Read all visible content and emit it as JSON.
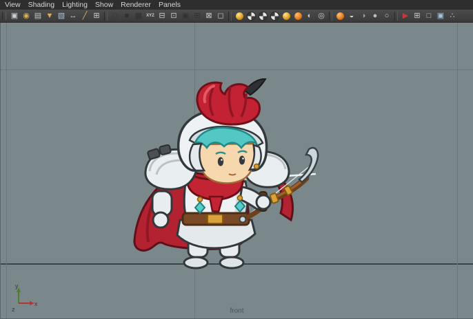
{
  "menu_bar": {
    "items": [
      "View",
      "Shading",
      "Lighting",
      "Show",
      "Renderer",
      "Panels"
    ]
  },
  "toolbar": {
    "groups": [
      {
        "icons": [
          {
            "name": "camera-select-icon",
            "kind": "glyph",
            "glyph": "▣",
            "color": "#c9ced2"
          },
          {
            "name": "camera-lock-icon",
            "kind": "glyph",
            "glyph": "◉",
            "color": "#d8b25a"
          },
          {
            "name": "camera-attributes-icon",
            "kind": "glyph",
            "glyph": "▤",
            "color": "#bfc6ca"
          },
          {
            "name": "bookmark-icon",
            "kind": "glyph",
            "glyph": "▼",
            "color": "#d8b25a"
          },
          {
            "name": "image-plane-icon",
            "kind": "glyph",
            "glyph": "▧",
            "color": "#9fc3d8"
          },
          {
            "name": "pan-zoom-icon",
            "kind": "glyph",
            "glyph": "↔",
            "color": "#cdd3d7"
          },
          {
            "name": "grease-pencil-icon",
            "kind": "glyph",
            "glyph": "╱",
            "color": "#d8b25a"
          },
          {
            "name": "grid-toggle-icon",
            "kind": "glyph",
            "glyph": "⊞",
            "color": "#c9ced2"
          }
        ]
      },
      {
        "icons": [
          {
            "name": "wireframe-icon",
            "kind": "glyph",
            "glyph": "□",
            "color": "#2e3235"
          },
          {
            "name": "shaded-icon",
            "kind": "glyph",
            "glyph": "■",
            "color": "#2e3235"
          },
          {
            "name": "textured-icon",
            "kind": "glyph",
            "glyph": "▩",
            "color": "#2e3235"
          },
          {
            "name": "xyz-icon",
            "kind": "text",
            "glyph": "XYZ",
            "color": "#cdd3d7"
          },
          {
            "name": "film-gate-icon",
            "kind": "glyph",
            "glyph": "⊟",
            "color": "#c9ced2"
          },
          {
            "name": "resolution-gate-icon",
            "kind": "glyph",
            "glyph": "⊡",
            "color": "#c9ced2"
          },
          {
            "name": "gate-mask-icon",
            "kind": "glyph",
            "glyph": "▣",
            "color": "#2e3235"
          },
          {
            "name": "field-chart-icon",
            "kind": "glyph",
            "glyph": "⊞",
            "color": "#2e3235"
          },
          {
            "name": "safe-action-icon",
            "kind": "glyph",
            "glyph": "⊠",
            "color": "#c9ced2"
          },
          {
            "name": "safe-title-icon",
            "kind": "glyph",
            "glyph": "◻",
            "color": "#c9ced2"
          }
        ]
      },
      {
        "icons": [
          {
            "name": "lighting-icon",
            "kind": "gold"
          },
          {
            "name": "shadows-icon",
            "kind": "checker"
          },
          {
            "name": "ambient-occlusion-icon",
            "kind": "checker"
          },
          {
            "name": "motion-blur-icon",
            "kind": "checker"
          },
          {
            "name": "render-globals-icon",
            "kind": "gold"
          },
          {
            "name": "texture-sphere-icon",
            "kind": "orange"
          },
          {
            "name": "ipr-icon",
            "kind": "glyph",
            "glyph": "◐",
            "color": "#c9ced2"
          },
          {
            "name": "snapshot-icon",
            "kind": "glyph",
            "glyph": "◎",
            "color": "#c9ced2"
          }
        ]
      },
      {
        "icons": [
          {
            "name": "isolate-select-icon",
            "kind": "orange"
          },
          {
            "name": "xray-icon",
            "kind": "glyph",
            "glyph": "◒",
            "color": "#c9ced2"
          },
          {
            "name": "half-shade-icon",
            "kind": "glyph",
            "glyph": "◑",
            "color": "#8fa8b8"
          },
          {
            "name": "sphere-display-icon",
            "kind": "glyph",
            "glyph": "●",
            "color": "#b9c0c5"
          },
          {
            "name": "outline-sphere-icon",
            "kind": "glyph",
            "glyph": "○",
            "color": "#c9ced2"
          }
        ]
      },
      {
        "icons": [
          {
            "name": "pick-icon",
            "kind": "glyph",
            "glyph": "▶",
            "color": "#c23a3a"
          },
          {
            "name": "subdiv-grid-icon",
            "kind": "glyph",
            "glyph": "⊞",
            "color": "#c9ced2"
          },
          {
            "name": "plane-icon",
            "kind": "glyph",
            "glyph": "□",
            "color": "#c9ced2"
          },
          {
            "name": "layer-stack-icon",
            "kind": "glyph",
            "glyph": "▣",
            "color": "#9fc3d8"
          },
          {
            "name": "share-icon",
            "kind": "glyph",
            "glyph": "∴",
            "color": "#c9ced2"
          }
        ]
      }
    ]
  },
  "viewport": {
    "camera_label": "front",
    "axis_labels": {
      "x": "x",
      "y": "y",
      "z": "z"
    },
    "colors": {
      "background": "#7b888b",
      "grid_line": "#6a767b",
      "axis_line": "#3c4549"
    },
    "character": {
      "name": "knight-archer-sprite",
      "colors": {
        "plume": "#c22233",
        "helmet": "#eef2f4",
        "hair": "#52c7c4",
        "skin": "#f6d7ae",
        "scarf": "#c32433",
        "cape": "#b32231",
        "armor": "#e9eef0",
        "belt": "#7a4a26",
        "gold": "#d9a23c",
        "bow_wood": "#6f4019",
        "bow_tip": "#cdd6da",
        "gem": "#57cdc9"
      }
    }
  }
}
